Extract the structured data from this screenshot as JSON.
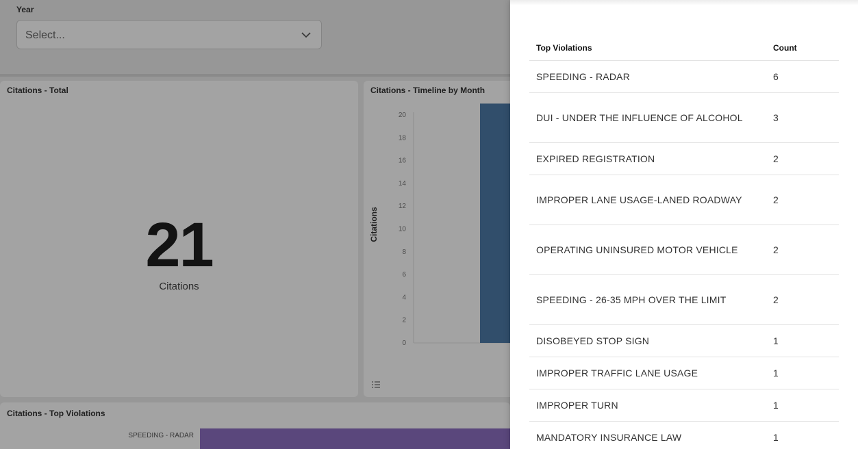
{
  "filters": {
    "year_label": "Year",
    "year_placeholder": "Select..."
  },
  "panels": {
    "total": {
      "title": "Citations - Total",
      "value": "21",
      "unit": "Citations"
    },
    "timeline": {
      "title": "Citations - Timeline by Month",
      "ylabel": "Citations"
    },
    "top_violations": {
      "title": "Citations - Top Violations",
      "first_category": "SPEEDING - RADAR"
    }
  },
  "chart_data": {
    "type": "bar",
    "title": "Citations - Timeline by Month",
    "ylabel": "Citations",
    "ylim": [
      0,
      20
    ],
    "yticks": [
      "20",
      "18",
      "16",
      "14",
      "12",
      "10",
      "8",
      "6",
      "4",
      "2",
      "0"
    ],
    "values": [
      21
    ]
  },
  "table": {
    "headers": {
      "name": "Top Violations",
      "count": "Count"
    },
    "rows": [
      {
        "name": "SPEEDING - RADAR",
        "count": "6"
      },
      {
        "name": "DUI - UNDER THE INFLUENCE OF ALCOHOL",
        "count": "3"
      },
      {
        "name": "EXPIRED REGISTRATION",
        "count": "2"
      },
      {
        "name": "IMPROPER LANE USAGE-LANED ROADWAY",
        "count": "2"
      },
      {
        "name": "OPERATING UNINSURED MOTOR VEHICLE",
        "count": "2"
      },
      {
        "name": "SPEEDING - 26-35 MPH OVER THE LIMIT",
        "count": "2"
      },
      {
        "name": "DISOBEYED STOP SIGN",
        "count": "1"
      },
      {
        "name": "IMPROPER TRAFFIC LANE USAGE",
        "count": "1"
      },
      {
        "name": "IMPROPER TURN",
        "count": "1"
      },
      {
        "name": "MANDATORY INSURANCE LAW",
        "count": "1"
      }
    ]
  },
  "colors": {
    "timeline_bar": "#4d7aa8",
    "violation_bar": "#8d6fc2"
  },
  "icons": {
    "select_chevron": "chevron-down-icon",
    "legend_toggle": "list-icon"
  }
}
